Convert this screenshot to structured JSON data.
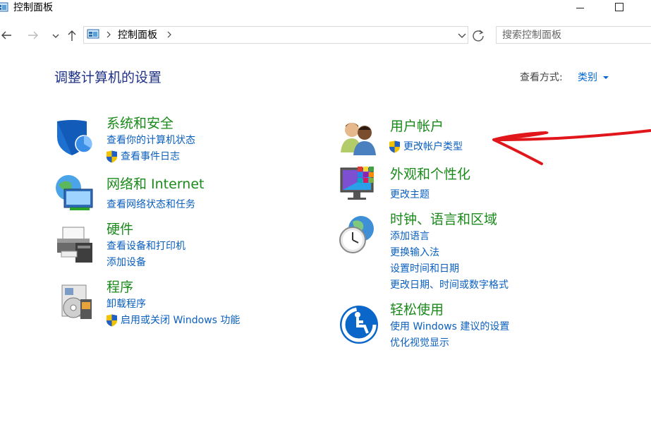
{
  "window": {
    "title": "控制面板"
  },
  "address_bar": {
    "breadcrumb": "控制面板"
  },
  "search": {
    "placeholder": "搜索控制面板"
  },
  "main": {
    "heading": "调整计算机的设置",
    "view_by": {
      "label": "查看方式:",
      "value": "类别"
    }
  },
  "categories": [
    {
      "title": "系统和安全",
      "links": [
        "查看你的计算机状态",
        "查看事件日志"
      ]
    },
    {
      "title": "网络和 Internet",
      "links": [
        "查看网络状态和任务"
      ]
    },
    {
      "title": "硬件",
      "links": [
        "查看设备和打印机",
        "添加设备"
      ]
    },
    {
      "title": "程序",
      "links": [
        "卸载程序",
        "启用或关闭 Windows 功能"
      ]
    },
    {
      "title": "用户帐户",
      "links": [
        "更改帐户类型"
      ]
    },
    {
      "title": "外观和个性化",
      "links": [
        "更改主题"
      ]
    },
    {
      "title": "时钟、语言和区域",
      "links": [
        "添加语言",
        "更换输入法",
        "设置时间和日期",
        "更改日期、时间或数字格式"
      ]
    },
    {
      "title": "轻松使用",
      "links": [
        "使用 Windows 建议的设置",
        "优化视觉显示"
      ]
    }
  ],
  "colors": {
    "heading": "#1e3287",
    "category_title": "#1a8a1a",
    "link": "#0a5fbf",
    "annotation_arrow": "#e0161b"
  }
}
